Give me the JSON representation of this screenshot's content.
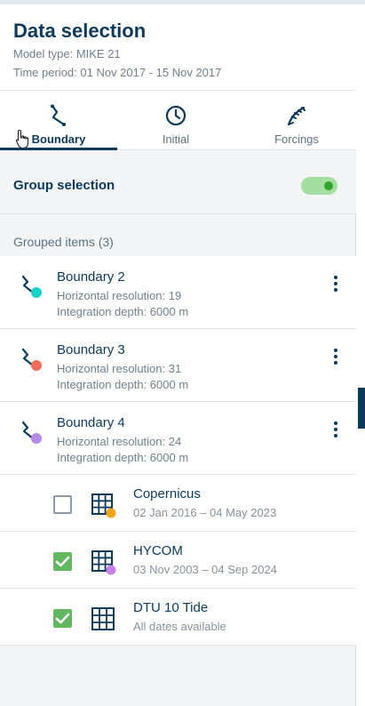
{
  "header": {
    "title": "Data selection",
    "model_type": "Model type: MIKE 21",
    "time_period": "Time period: 01 Nov 2017 - 15 Nov 2017"
  },
  "tabs": [
    {
      "label": "Boundary",
      "icon": "boundary-icon",
      "active": true
    },
    {
      "label": "Initial",
      "icon": "clock-icon",
      "active": false
    },
    {
      "label": "Forcings",
      "icon": "forcings-icon",
      "active": false
    }
  ],
  "group_selection": {
    "label": "Group selection",
    "enabled": true,
    "toggle_color": "#2fa52a"
  },
  "grouped_items": {
    "header": "Grouped items (3)",
    "items": [
      {
        "name": "Boundary 2",
        "resolution": "Horizontal resolution: 19",
        "depth": "Integration depth: 6000 m",
        "color": "#19d2c9"
      },
      {
        "name": "Boundary 3",
        "resolution": "Horizontal resolution: 31",
        "depth": "Integration depth: 6000 m",
        "color": "#f26b5b"
      },
      {
        "name": "Boundary 4",
        "resolution": "Horizontal resolution: 24",
        "depth": "Integration depth: 6000 m",
        "color": "#b58be6"
      }
    ]
  },
  "sources": [
    {
      "name": "Copernicus",
      "dates": "02 Jan 2016 – 04 May 2023",
      "checked": false,
      "color": "#f2a51a"
    },
    {
      "name": "HYCOM",
      "dates": "03 Nov 2003 – 04 Sep 2024",
      "checked": true,
      "color": "#c77ee8"
    },
    {
      "name": "DTU 10 Tide",
      "dates": "All dates available",
      "checked": true,
      "color": null
    }
  ]
}
